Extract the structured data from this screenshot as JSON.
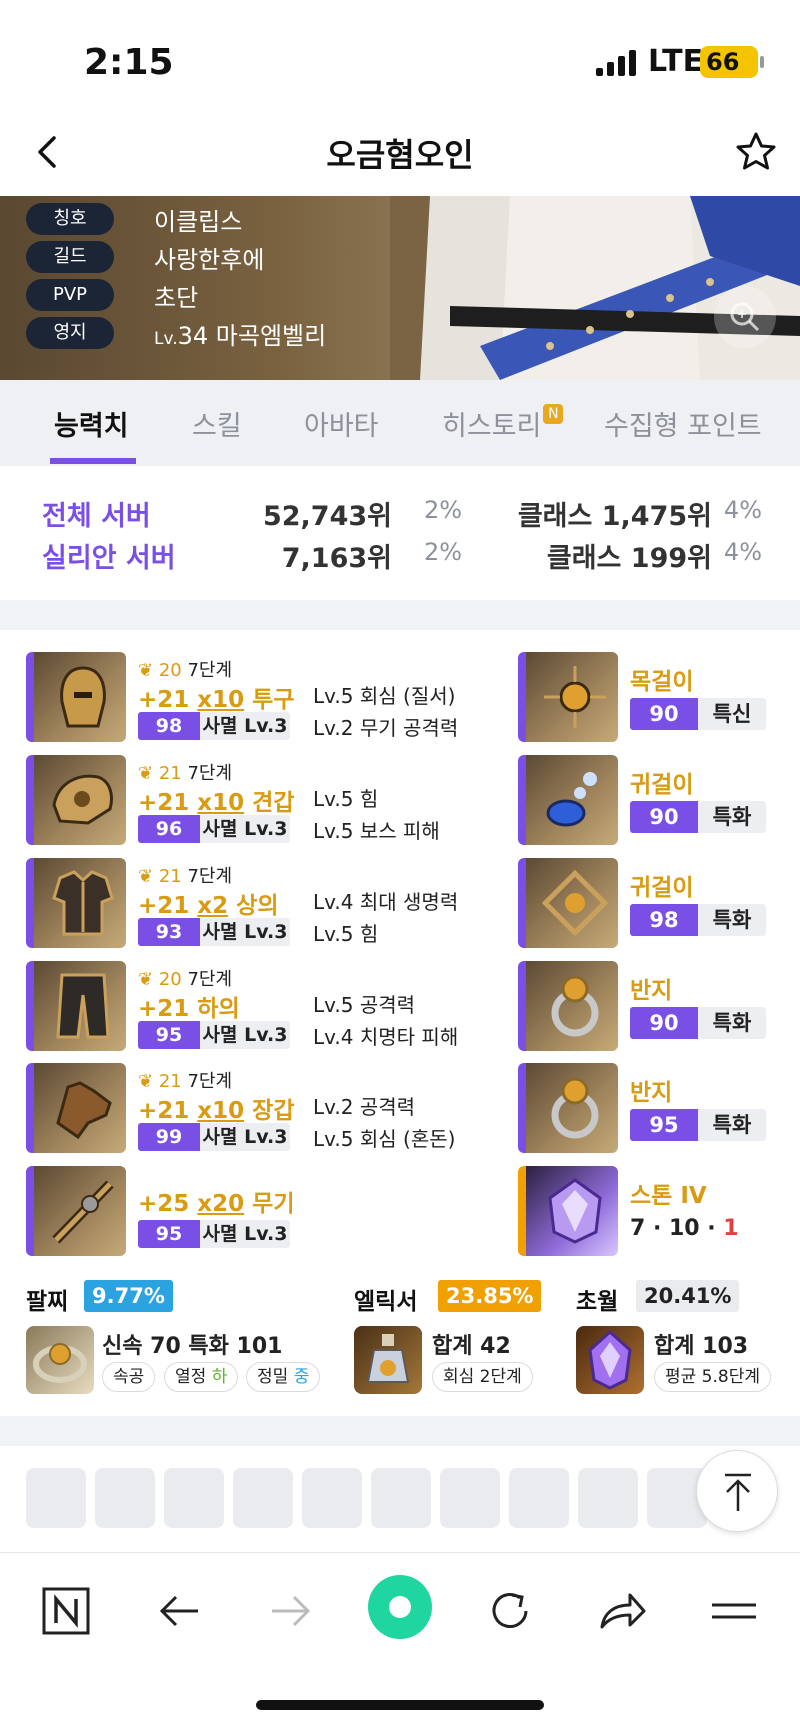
{
  "status_bar": {
    "time": "2:15",
    "network": "LTE",
    "battery": "66"
  },
  "header": {
    "title": "오금혐오인"
  },
  "profile": [
    {
      "tag": "칭호",
      "value": "이클립스"
    },
    {
      "tag": "길드",
      "value": "사랑한후에"
    },
    {
      "tag": "PVP",
      "value": "초단"
    },
    {
      "tag": "영지",
      "value_prefix": "Lv.",
      "value": "34 마곡엠벨리"
    }
  ],
  "tabs": [
    {
      "label": "능력치",
      "active": true
    },
    {
      "label": "스킬"
    },
    {
      "label": "아바타"
    },
    {
      "label": "히스토리",
      "badge": "N"
    },
    {
      "label": "수집형 포인트"
    }
  ],
  "ranks": [
    {
      "server": "전체 서버",
      "rank": "52,743위",
      "pct": "2%",
      "class_rank": "클래스 1,475위",
      "class_pct": "4%"
    },
    {
      "server": "실리안 서버",
      "rank": "7,163위",
      "pct": "2%",
      "class_rank": "클래스 199위",
      "class_pct": "4%"
    }
  ],
  "equipment": [
    {
      "quality_icon": "laurel-icon",
      "elixir": "20",
      "stage": "7단계",
      "plus": "+21",
      "adv": "x10",
      "slot": "투구",
      "quality": "98",
      "set": "사멸 Lv.3",
      "eff1": "Lv.5 회심 (질서)",
      "eff2": "Lv.2 무기 공격력"
    },
    {
      "quality_icon": "laurel-icon",
      "elixir": "21",
      "stage": "7단계",
      "plus": "+21",
      "adv": "x10",
      "slot": "견갑",
      "quality": "96",
      "set": "사멸 Lv.3",
      "eff1": "Lv.5 힘",
      "eff2": "Lv.5 보스 피해"
    },
    {
      "quality_icon": "laurel-icon",
      "elixir": "21",
      "stage": "7단계",
      "plus": "+21",
      "adv": "x2",
      "slot": "상의",
      "quality": "93",
      "set": "사멸 Lv.3",
      "eff1": "Lv.4 최대 생명력",
      "eff2": "Lv.5 힘"
    },
    {
      "quality_icon": "laurel-icon",
      "elixir": "20",
      "stage": "7단계",
      "plus": "+21",
      "adv": "",
      "slot": "하의",
      "quality": "95",
      "set": "사멸 Lv.3",
      "eff1": "Lv.5 공격력",
      "eff2": "Lv.4 치명타 피해"
    },
    {
      "quality_icon": "laurel-icon",
      "elixir": "21",
      "stage": "7단계",
      "plus": "+21",
      "adv": "x10",
      "slot": "장갑",
      "quality": "99",
      "set": "사멸 Lv.3",
      "eff1": "Lv.2 공격력",
      "eff2": "Lv.5 회심 (혼돈)"
    },
    {
      "plus": "+25",
      "adv": "x20",
      "slot": "무기",
      "quality": "95",
      "set": "사멸 Lv.3"
    }
  ],
  "accessories": [
    {
      "name": "목걸이",
      "quality": "90",
      "stat": "특신"
    },
    {
      "name": "귀걸이",
      "quality": "90",
      "stat": "특화"
    },
    {
      "name": "귀걸이",
      "quality": "98",
      "stat": "특화"
    },
    {
      "name": "반지",
      "quality": "90",
      "stat": "특화"
    },
    {
      "name": "반지",
      "quality": "95",
      "stat": "특화"
    },
    {
      "name": "스톤 IV",
      "line_a": "7 · 10 · ",
      "line_b": "1"
    }
  ],
  "bracelet": {
    "title": "팔찌",
    "pct": "9.77%",
    "text": "신속 70 특화 101",
    "pills": [
      "속공",
      "열정 ",
      "하",
      "정밀 ",
      "중"
    ]
  },
  "elixir": {
    "title": "엘릭서",
    "pct": "23.85%",
    "text": "합계 42",
    "pill": "회심 2단계"
  },
  "transcend": {
    "title": "초월",
    "pct": "20.41%",
    "text": "합계 103",
    "pill": "평균 5.8단계"
  },
  "colors": {
    "accent": "#7a4fe6",
    "gold": "#d89b12",
    "bracelet_badge": "#2aa3e0",
    "elixir_badge": "#f0a000",
    "transcend_badge": "#e9ebee"
  }
}
